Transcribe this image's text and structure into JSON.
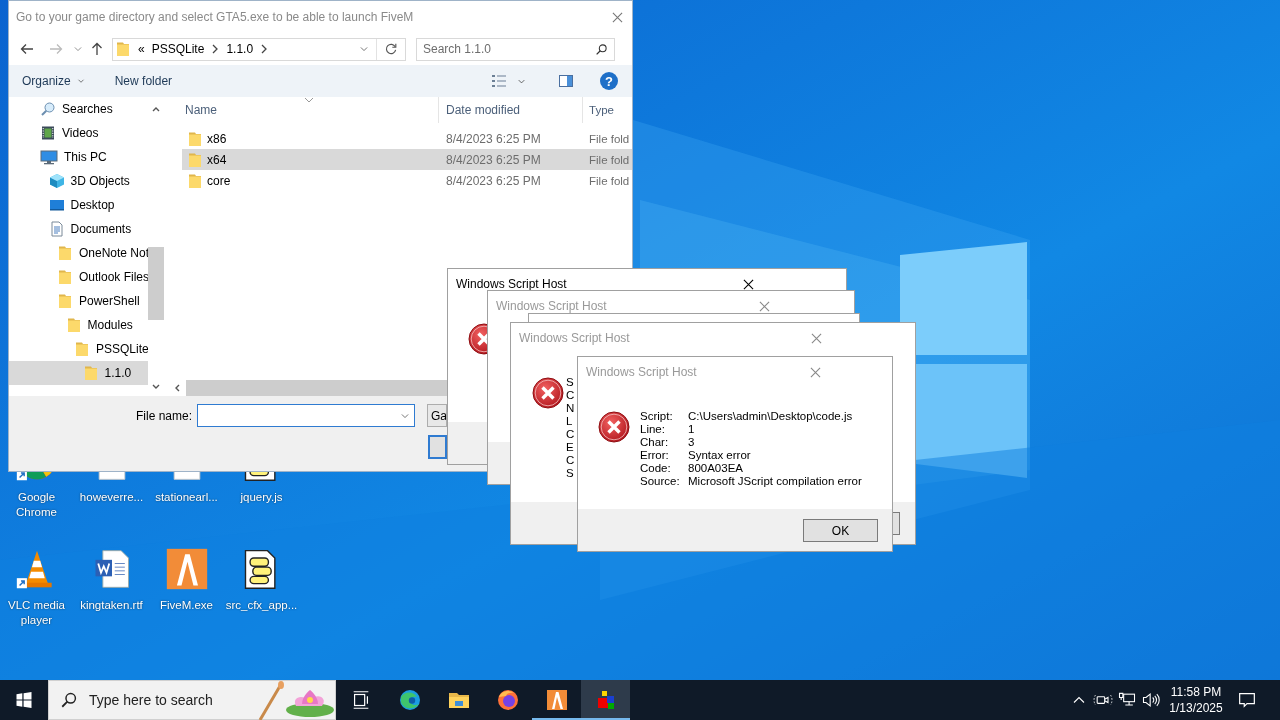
{
  "file_dialog": {
    "title": "Go to your game directory and select GTA5.exe to be able to launch FiveM",
    "address": [
      "«",
      "PSSQLite",
      "1.1.0"
    ],
    "search_placeholder": "Search 1.1.0",
    "toolbar": [
      {
        "label": "Organize",
        "kind": "menu"
      },
      {
        "label": "New folder",
        "kind": "button"
      }
    ],
    "help": "?",
    "tree": [
      {
        "label": "Searches",
        "kind": "search",
        "selected": false
      },
      {
        "label": "Videos",
        "kind": "video",
        "selected": false
      },
      {
        "label": "This PC",
        "kind": "pc",
        "selected": false,
        "children": [
          {
            "label": "3D Objects",
            "kind": "cube",
            "selected": false
          },
          {
            "label": "Desktop",
            "kind": "desktop",
            "selected": false
          },
          {
            "label": "Documents",
            "kind": "document",
            "selected": false,
            "children": [
              {
                "label": "OneNote Not",
                "kind": "folder",
                "selected": false
              },
              {
                "label": "Outlook Files",
                "kind": "folder",
                "selected": false
              },
              {
                "label": "PowerShell",
                "kind": "folder",
                "selected": false,
                "children": [
                  {
                    "label": "Modules",
                    "kind": "folder",
                    "selected": false,
                    "children": [
                      {
                        "label": "PSSQLite",
                        "kind": "folder",
                        "selected": false,
                        "children": [
                          {
                            "label": "1.1.0",
                            "kind": "folder",
                            "selected": true
                          }
                        ]
                      }
                    ]
                  }
                ]
              }
            ]
          }
        ]
      }
    ],
    "columns": [
      "Name",
      "Date modified",
      "Type"
    ],
    "files": [
      {
        "name": "x86",
        "date": "8/4/2023 6:25 PM",
        "type": "File fold",
        "selected": false
      },
      {
        "name": "x64",
        "date": "8/4/2023 6:25 PM",
        "type": "File fold",
        "selected": true
      },
      {
        "name": "core",
        "date": "8/4/2023 6:25 PM",
        "type": "File fold",
        "selected": false
      }
    ],
    "file_name_label": "File name:",
    "filter": "Ga"
  },
  "script_dialogs": [
    {
      "title": "Windows Script Host",
      "active": true
    },
    {
      "title": "Windows Script Host",
      "active": false
    },
    {
      "title": "Windows Script Host",
      "active": false,
      "labels": [
        "S",
        "C",
        "N",
        "L",
        "C",
        "E",
        "C",
        "S"
      ]
    },
    {
      "title": "Windows Script Host",
      "active": false,
      "details": [
        {
          "label": "Script:",
          "value": "C:\\Users\\admin\\Desktop\\code.js"
        },
        {
          "label": "Line:",
          "value": "1"
        },
        {
          "label": "Char:",
          "value": "3"
        },
        {
          "label": "Error:",
          "value": "Syntax error"
        },
        {
          "label": "Code:",
          "value": "800A03EA"
        },
        {
          "label": "Source:",
          "value": "Microsoft JScript compilation error"
        }
      ],
      "button": "OK"
    }
  ],
  "desktop_icons": [
    {
      "label": "Google Chrome",
      "kind": "chrome"
    },
    {
      "label": "howeverre...",
      "kind": "blank"
    },
    {
      "label": "stationearl...",
      "kind": "blank"
    },
    {
      "label": "jquery.js",
      "kind": "script"
    },
    {
      "label": "VLC media player",
      "kind": "vlc"
    },
    {
      "label": "kingtaken.rtf",
      "kind": "word"
    },
    {
      "label": "FiveM.exe",
      "kind": "fivem"
    },
    {
      "label": "src_cfx_app...",
      "kind": "script"
    }
  ],
  "taskbar": {
    "search_placeholder": "Type here to search",
    "apps": [
      {
        "kind": "task_view",
        "running": false,
        "selected": false
      },
      {
        "kind": "edge",
        "running": false,
        "selected": false
      },
      {
        "kind": "explorer",
        "running": false,
        "selected": false
      },
      {
        "kind": "firefox",
        "running": false,
        "selected": false
      },
      {
        "kind": "fivem",
        "running": true,
        "selected": false
      },
      {
        "kind": "cubes",
        "running": true,
        "selected": true
      }
    ],
    "time": "11:58 PM",
    "date": "1/13/2025"
  }
}
